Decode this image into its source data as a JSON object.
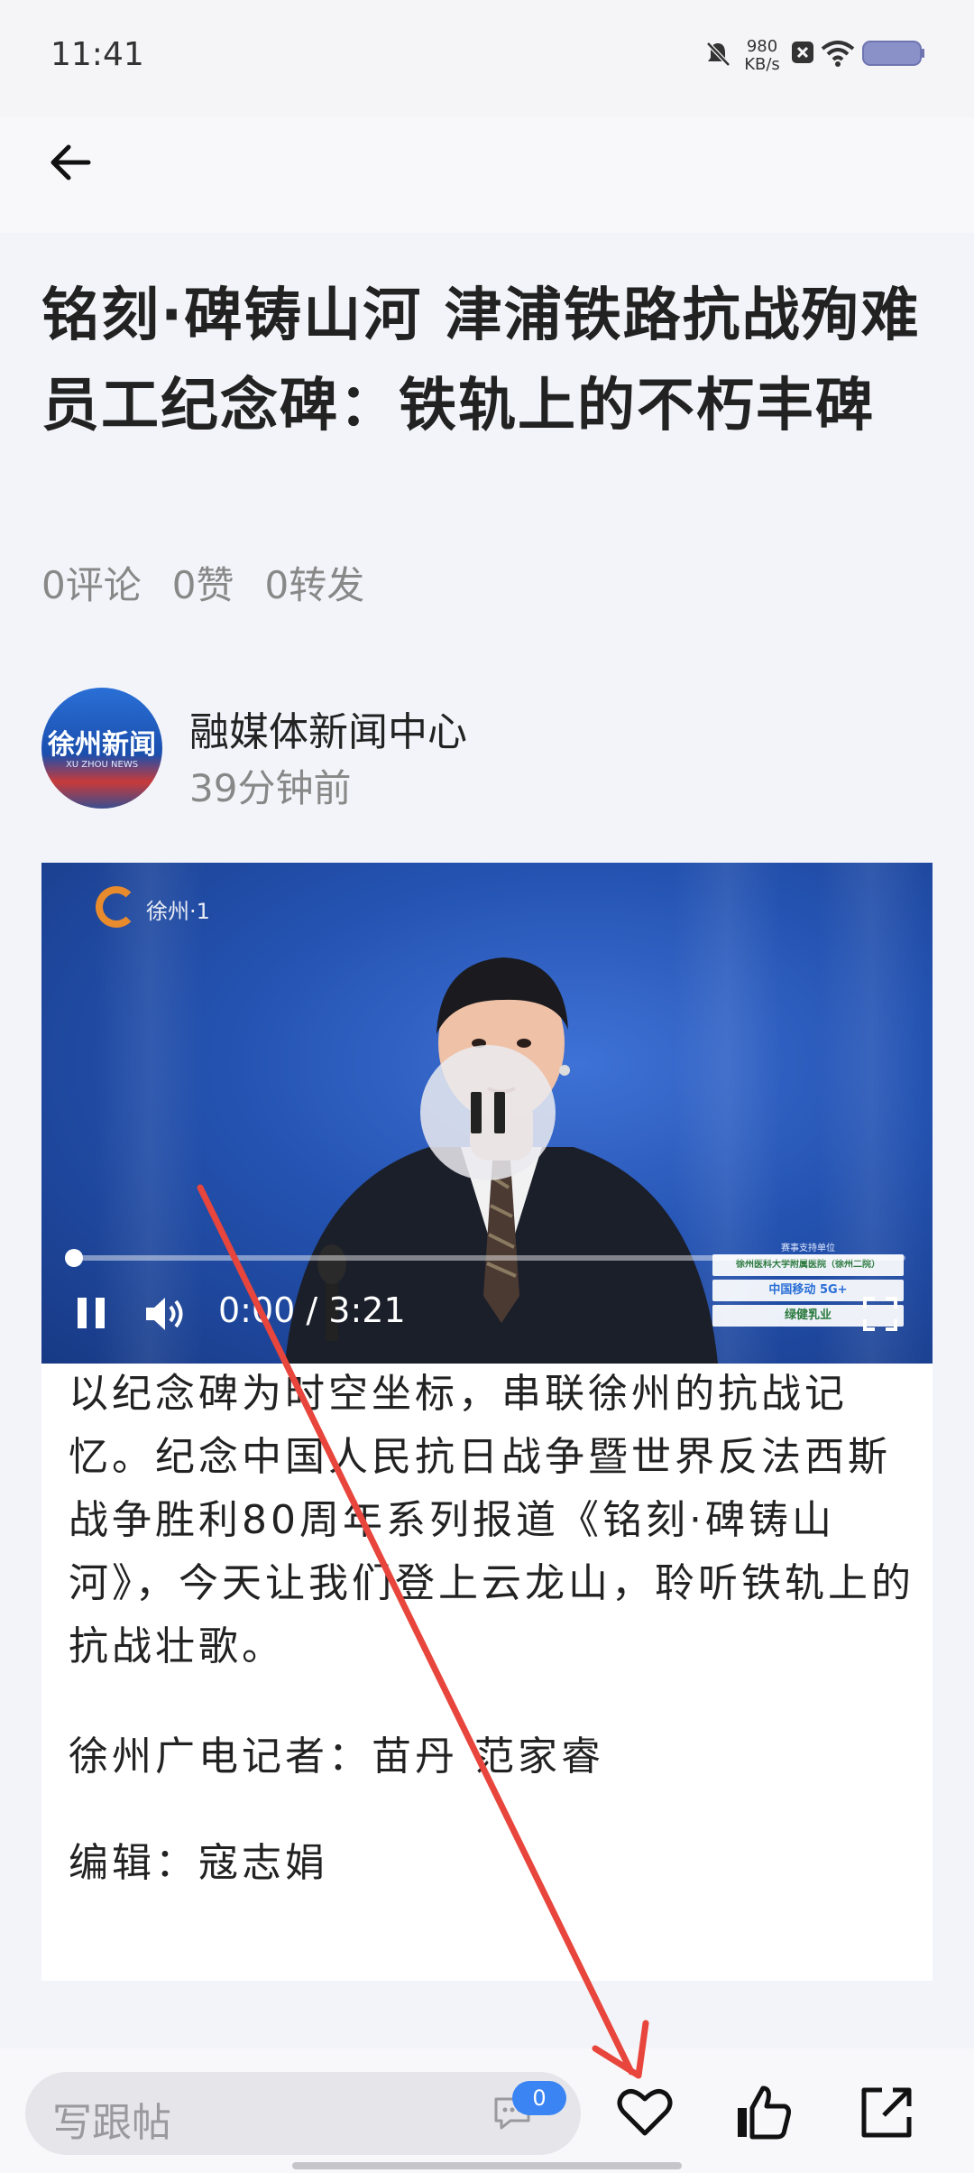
{
  "status_bar": {
    "time": "11:41",
    "net_speed_value": "980",
    "net_speed_unit": "KB/s",
    "icons": [
      "mute-bell-icon",
      "no-sim-icon",
      "wifi-icon",
      "battery-icon"
    ]
  },
  "header": {
    "back_icon": "back-arrow-icon"
  },
  "article": {
    "title": "铭刻·碑铸山河  津浦铁路抗战殉难员工纪念碑：铁轨上的不朽丰碑",
    "stats": {
      "comments": "0评论",
      "likes": "0赞",
      "shares": "0转发"
    },
    "author": {
      "name": "融媒体新闻中心",
      "time": "39分钟前",
      "avatar_text": "徐州新闻",
      "avatar_subtext": "XU ZHOU NEWS"
    },
    "video": {
      "channel_label": "徐州·1",
      "time": "0:00 / 3:21",
      "progress": 0.0,
      "sponsor_header": "赛事支持单位",
      "sponsors": [
        "徐州医科大学附属医院（徐州二院）",
        "中国移动 5G+",
        "绿健乳业"
      ]
    },
    "body": "以纪念碑为时空坐标，串联徐州的抗战记忆。纪念中国人民抗日战争暨世界反法西斯战争胜利80周年系列报道《铭刻·碑铸山河》，今天让我们登上云龙山，聆听铁轨上的抗战壮歌。",
    "reporter": "徐州广电记者：苗丹 范家睿",
    "editor": "编辑：寇志娟"
  },
  "bottom_bar": {
    "comment_placeholder": "写跟帖",
    "comment_count": "0",
    "icons": [
      "heart-icon",
      "thumbs-up-icon",
      "share-icon"
    ]
  },
  "colors": {
    "accent": "#3a84f4",
    "annotation": "#e8453c"
  }
}
